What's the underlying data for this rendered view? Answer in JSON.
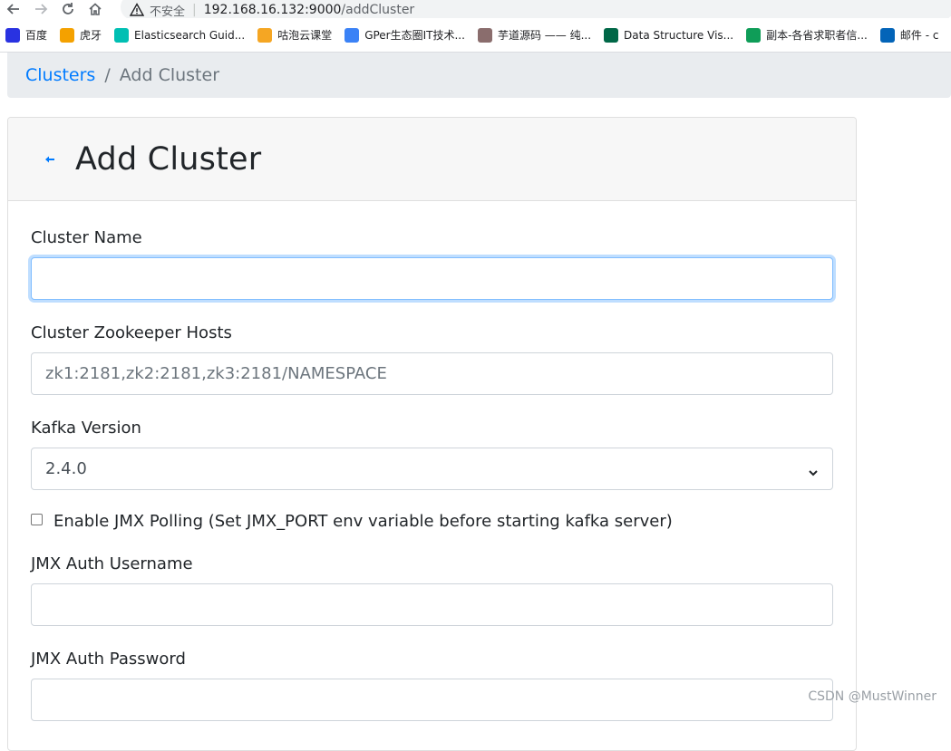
{
  "browser": {
    "insecure_label": "不安全",
    "url_host": "192.168.16.132:9000",
    "url_path": "/addCluster",
    "bookmarks": [
      {
        "label": "百度",
        "icon": "baidu-icon",
        "color": "#2932e1"
      },
      {
        "label": "虎牙",
        "icon": "huya-icon",
        "color": "#f4a100"
      },
      {
        "label": "Elasticsearch Guid...",
        "icon": "elastic-icon",
        "color": "#00bfb3"
      },
      {
        "label": "咕泡云课堂",
        "icon": "bulb-icon",
        "color": "#f5a623"
      },
      {
        "label": "GPer生态圈IT技术...",
        "icon": "gper-icon",
        "color": "#3b82f6"
      },
      {
        "label": "芋道源码 —— 纯...",
        "icon": "avatar-icon",
        "color": "#8a6d6d"
      },
      {
        "label": "Data Structure Vis...",
        "icon": "usf-icon",
        "color": "#006747"
      },
      {
        "label": "副本-各省求职者信...",
        "icon": "sheets-icon",
        "color": "#0f9d58"
      },
      {
        "label": "邮件 - c",
        "icon": "outlook-icon",
        "color": "#0364b8"
      }
    ]
  },
  "breadcrumb": {
    "link": "Clusters",
    "separator": "/",
    "current": "Add Cluster"
  },
  "card": {
    "title": "Add Cluster"
  },
  "form": {
    "cluster_name": {
      "label": "Cluster Name",
      "value": "",
      "placeholder": ""
    },
    "zk_hosts": {
      "label": "Cluster Zookeeper Hosts",
      "value": "",
      "placeholder": "zk1:2181,zk2:2181,zk3:2181/NAMESPACE"
    },
    "kafka_version": {
      "label": "Kafka Version",
      "selected": "2.4.0"
    },
    "jmx_polling": {
      "label": "Enable JMX Polling (Set JMX_PORT env variable before starting kafka server)",
      "checked": false
    },
    "jmx_username": {
      "label": "JMX Auth Username",
      "value": ""
    },
    "jmx_password": {
      "label": "JMX Auth Password",
      "value": ""
    }
  },
  "watermark": "CSDN @MustWinner",
  "colors": {
    "link": "#007bff",
    "focus_border": "#80bdff",
    "breadcrumb_bg": "#e9ecef",
    "card_header_bg": "#f7f7f7"
  }
}
